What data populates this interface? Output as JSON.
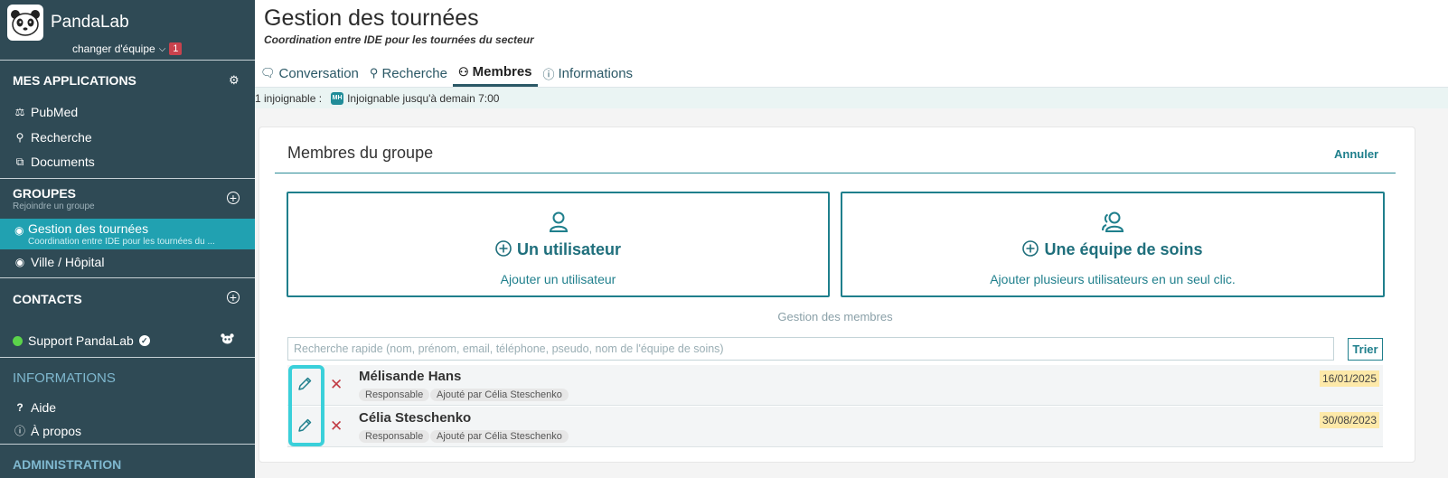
{
  "app": {
    "name": "PandaLab",
    "team_switch": "changer d'équipe",
    "team_badge": "1"
  },
  "sidebar": {
    "apps_title": "MES APPLICATIONS",
    "apps": [
      {
        "label": "PubMed",
        "icon": "pubmed-icon"
      },
      {
        "label": "Recherche",
        "icon": "search-icon"
      },
      {
        "label": "Documents",
        "icon": "paperclip-icon"
      }
    ],
    "groups_title": "GROUPES",
    "groups_subtitle": "Rejoindre un groupe",
    "groups": [
      {
        "label": "Gestion des tournées",
        "subtitle": "Coordination entre IDE pour les tournées du ...",
        "active": true
      },
      {
        "label": "Ville / Hôpital",
        "active": false
      }
    ],
    "contacts_title": "CONTACTS",
    "contacts": [
      {
        "label": "Support PandaLab",
        "status_color": "#5bd34a"
      }
    ],
    "info_title": "INFORMATIONS",
    "info_items": [
      {
        "label": "Aide",
        "icon": "question-icon"
      },
      {
        "label": "À propos",
        "icon": "info-icon"
      }
    ],
    "admin_title": "ADMINISTRATION"
  },
  "header": {
    "title": "Gestion des tournées",
    "subtitle": "Coordination entre IDE pour les tournées du secteur"
  },
  "tabs": [
    {
      "label": "Conversation",
      "icon": "chat-icon"
    },
    {
      "label": "Recherche",
      "icon": "search-icon"
    },
    {
      "label": "Membres",
      "icon": "members-icon",
      "active": true
    },
    {
      "label": "Informations",
      "icon": "info-icon"
    }
  ],
  "status_bar": {
    "count_text": "1 injoignable :",
    "badge": "MH",
    "text": "Injoignable jusqu'à demain 7:00"
  },
  "members_panel": {
    "title": "Membres du groupe",
    "cancel_label": "Annuler",
    "add_user": {
      "title": "Un utilisateur",
      "desc": "Ajouter un utilisateur"
    },
    "add_team": {
      "title": "Une équipe de soins",
      "desc": "Ajouter plusieurs utilisateurs en un seul clic."
    },
    "management_label": "Gestion des membres",
    "search_placeholder": "Recherche rapide (nom, prénom, email, téléphone, pseudo, nom de l'équipe de soins)",
    "sort_label": "Trier",
    "members": [
      {
        "name": "Mélisande Hans",
        "role": "Responsable",
        "added_by": "Ajouté par Célia Steschenko",
        "date": "16/01/2025"
      },
      {
        "name": "Célia Steschenko",
        "role": "Responsable",
        "added_by": "Ajouté par Célia Steschenko",
        "date": "30/08/2023"
      }
    ]
  },
  "colors": {
    "sidebar_bg": "#2f4a55",
    "accent": "#1f7f8c",
    "active_item": "#21a1b1",
    "delete": "#c23c45",
    "date_badge": "#fde9a9"
  }
}
